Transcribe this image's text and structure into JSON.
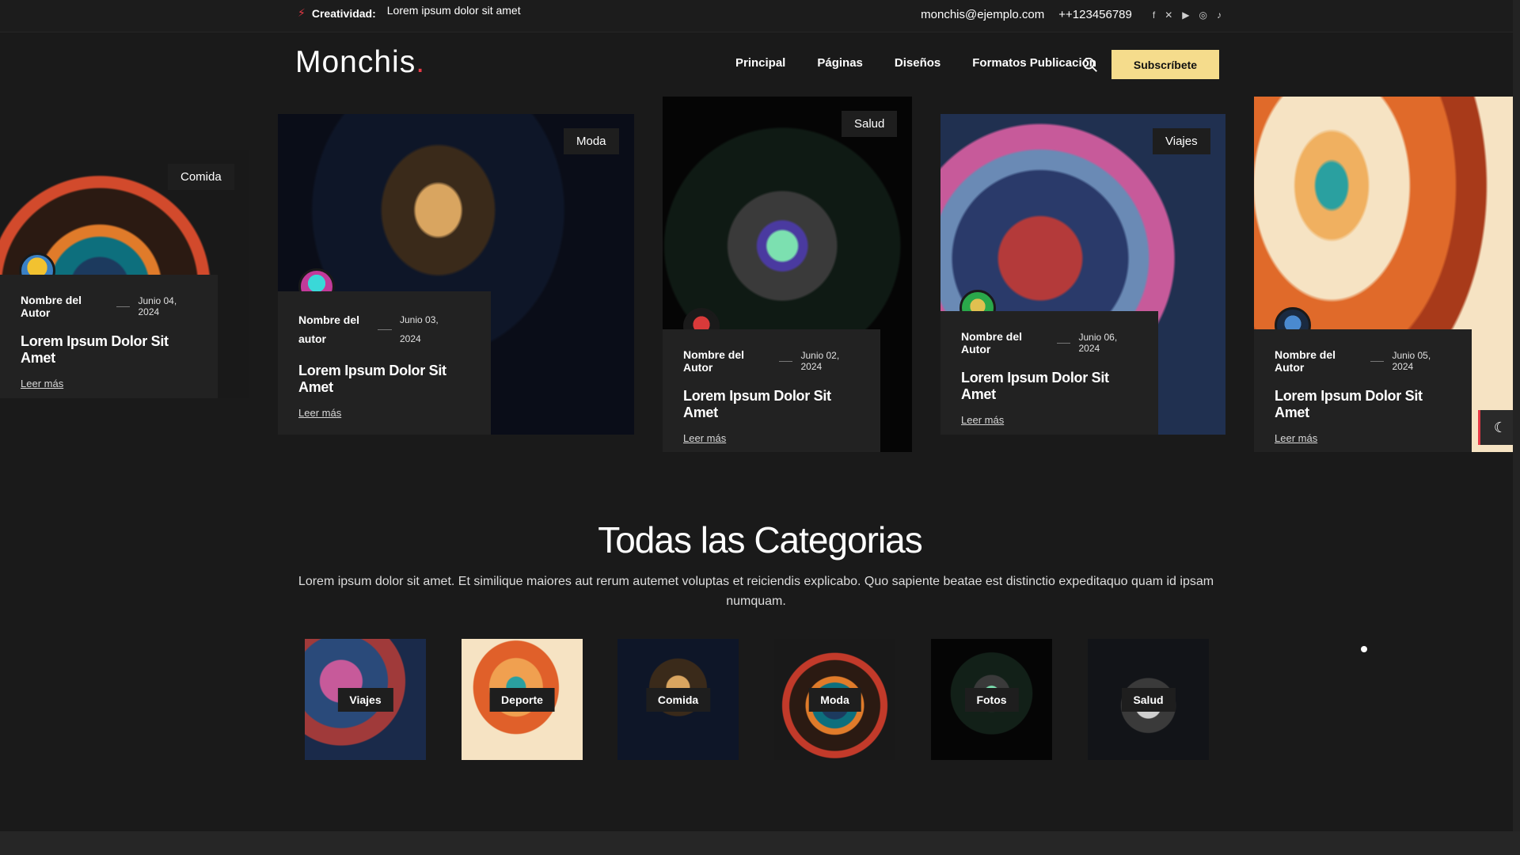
{
  "topbar": {
    "ticker_label": "Creatividad:",
    "ticker_text": "Lorem ipsum dolor sit amet",
    "email": "monchis@ejemplo.com",
    "phone": "++123456789",
    "socials": [
      "facebook-icon",
      "x-icon",
      "youtube-icon",
      "instagram-icon",
      "tiktok-icon"
    ]
  },
  "header": {
    "logo": "Monchis",
    "logo_dot": ".",
    "nav": [
      "Principal",
      "Páginas",
      "Diseños",
      "Formatos Publicación"
    ],
    "subscribe": "Subscríbete"
  },
  "cards": [
    {
      "tag": "Comida",
      "author": "Nombre del Autor",
      "date": "Junio 04, 2024",
      "title": "Lorem Ipsum Dolor Sit Amet",
      "more": "Leer más"
    },
    {
      "tag": "Moda",
      "author": "Nombre del autor",
      "date": "Junio 03, 2024",
      "title": "Lorem Ipsum Dolor Sit Amet",
      "more": "Leer más"
    },
    {
      "tag": "Salud",
      "author": "Nombre del Autor",
      "date": "Junio 02, 2024",
      "title": "Lorem Ipsum Dolor Sit Amet",
      "more": "Leer más"
    },
    {
      "tag": "Viajes",
      "author": "Nombre del Autor",
      "date": "Junio 06, 2024",
      "title": "Lorem Ipsum Dolor Sit Amet",
      "more": "Leer más"
    },
    {
      "tag": "",
      "author": "Nombre del Autor",
      "date": "Junio 05, 2024",
      "title": "Lorem Ipsum Dolor Sit Amet",
      "more": "Leer más"
    }
  ],
  "categories": {
    "title": "Todas las Categorias",
    "description": "Lorem ipsum dolor sit amet. Et similique maiores aut rerum autemet voluptas et reiciendis explicabo. Quo sapiente beatae est distinctio expeditaquo quam id ipsam numquam.",
    "items": [
      "Viajes",
      "Deporte",
      "Comida",
      "Moda",
      "Fotos",
      "Salud"
    ]
  },
  "colors": {
    "accent": "#e63946",
    "subscribe_bg": "#f5dc8c",
    "background": "#1a1a1a",
    "card_info_bg": "#222222"
  }
}
